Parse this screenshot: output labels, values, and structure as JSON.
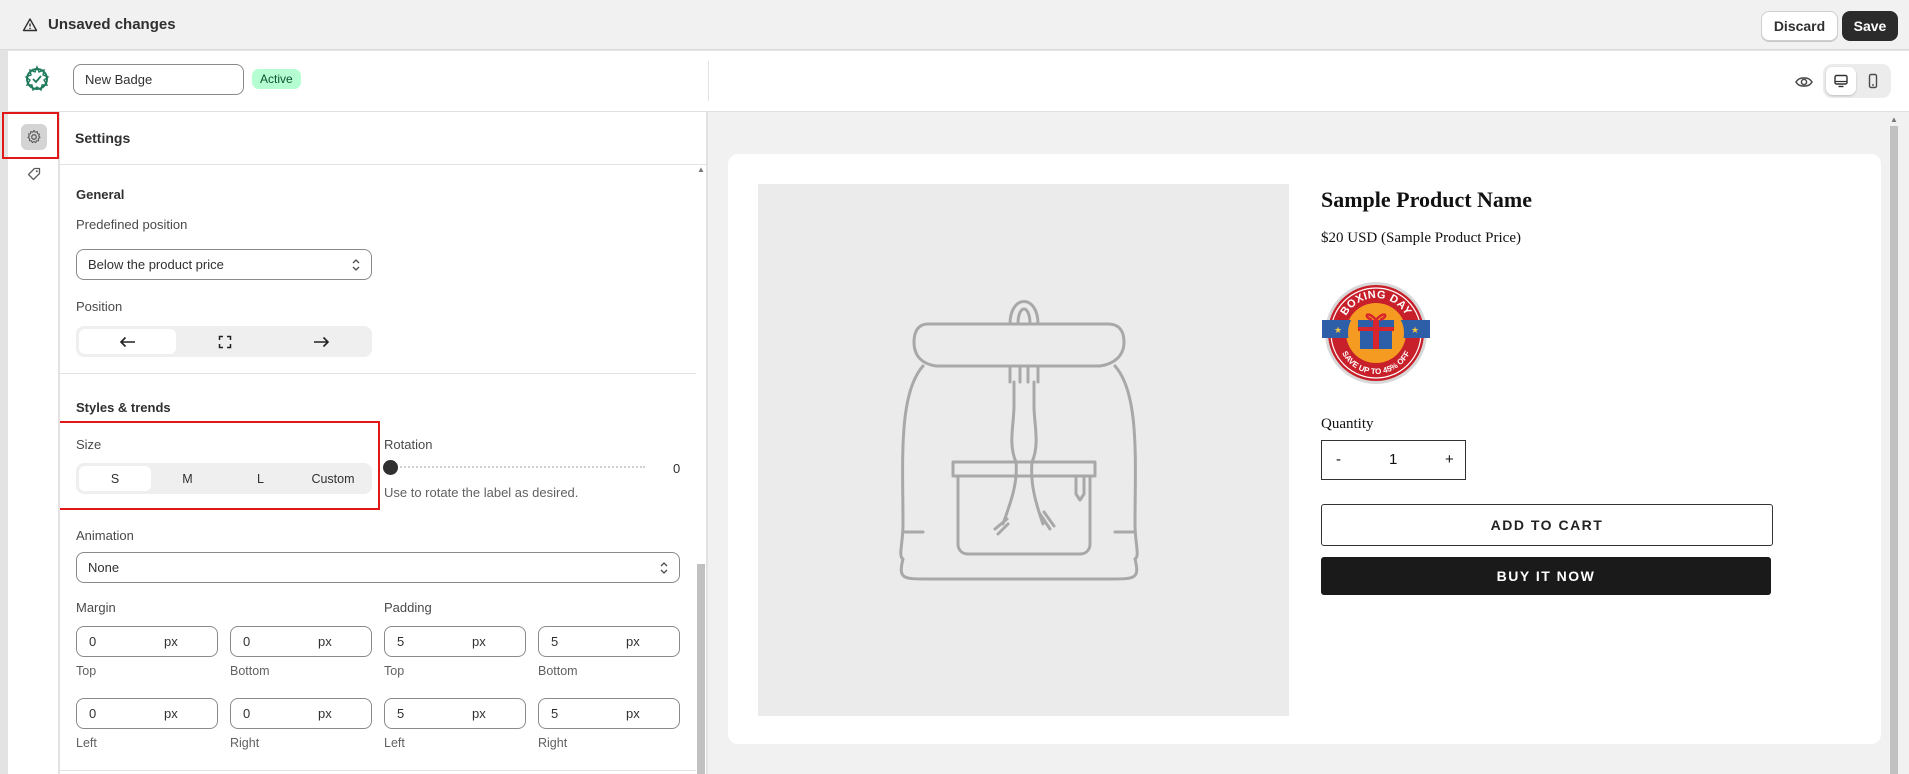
{
  "topbar": {
    "title": "Unsaved changes",
    "discard": "Discard",
    "save": "Save"
  },
  "header": {
    "badge_name": "New Badge",
    "status": "Active"
  },
  "panel": {
    "title": "Settings",
    "general": {
      "title": "General",
      "predefined_label": "Predefined position",
      "predefined_value": "Below the product price",
      "position_label": "Position",
      "position_options": [
        "left-arrow",
        "center-focus",
        "right-arrow"
      ],
      "position_selected": 0
    },
    "styles": {
      "title": "Styles & trends",
      "size_label": "Size",
      "sizes": [
        "S",
        "M",
        "L",
        "Custom"
      ],
      "size_selected": "S",
      "rotation_label": "Rotation",
      "rotation_value": "0",
      "rotation_help": "Use to rotate the label as desired.",
      "animation_label": "Animation",
      "animation_value": "None",
      "margin_label": "Margin",
      "padding_label": "Padding",
      "unit": "px",
      "margin": {
        "top": "0",
        "bottom": "0",
        "left": "0",
        "right": "0"
      },
      "padding": {
        "top": "5",
        "bottom": "5",
        "left": "5",
        "right": "5"
      },
      "labels": {
        "top": "Top",
        "bottom": "Bottom",
        "left": "Left",
        "right": "Right"
      }
    }
  },
  "preview": {
    "product_name": "Sample Product Name",
    "price": "$20 USD (Sample Product Price)",
    "badge_text_top": "BOXING DAY",
    "badge_text_bottom": "SAVE UP TO 45% OFF",
    "quantity_label": "Quantity",
    "qty_minus": "-",
    "qty_value": "1",
    "qty_plus": "+",
    "add_to_cart": "ADD TO CART",
    "buy_now": "BUY IT NOW"
  },
  "colors": {
    "highlight": "#e01818",
    "active_badge_bg": "#b4fed2",
    "primary_dark": "#2b2b2b",
    "badge_red": "#c8202a",
    "badge_orange": "#f59b22",
    "badge_blue": "#2c5fa8"
  }
}
